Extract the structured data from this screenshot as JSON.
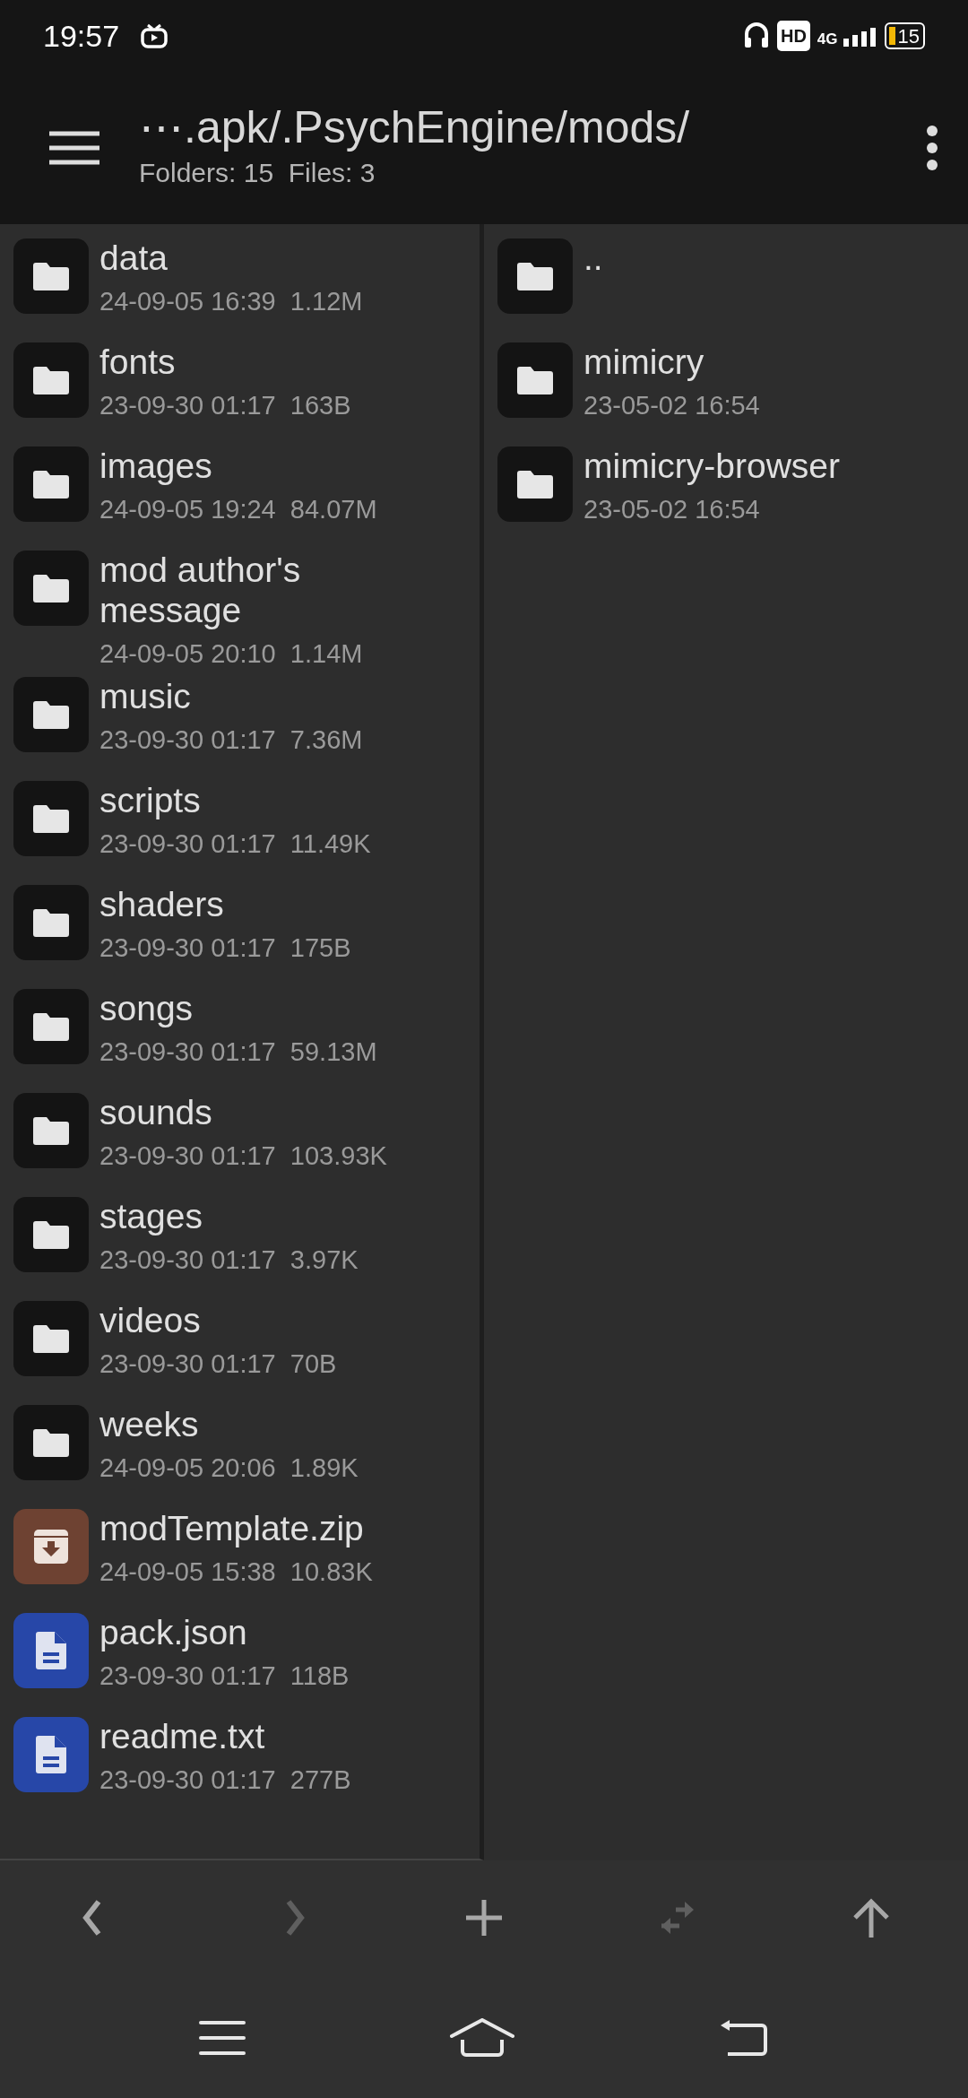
{
  "status_bar": {
    "time": "19:57",
    "hd": "HD",
    "network": "4G",
    "battery": "15"
  },
  "header": {
    "path": "⋯.apk/.PsychEngine/mods/",
    "summary": "Folders: 15  Files: 3"
  },
  "left_pane": {
    "items": [
      {
        "kind": "folder",
        "name": "data",
        "meta": "24-09-05 16:39  1.12M"
      },
      {
        "kind": "folder",
        "name": "fonts",
        "meta": "23-09-30 01:17  163B"
      },
      {
        "kind": "folder",
        "name": "images",
        "meta": "24-09-05 19:24  84.07M"
      },
      {
        "kind": "folder",
        "name": "mod author's message",
        "meta": "24-09-05 20:10  1.14M"
      },
      {
        "kind": "folder",
        "name": "music",
        "meta": "23-09-30 01:17  7.36M"
      },
      {
        "kind": "folder",
        "name": "scripts",
        "meta": "23-09-30 01:17  11.49K"
      },
      {
        "kind": "folder",
        "name": "shaders",
        "meta": "23-09-30 01:17  175B"
      },
      {
        "kind": "folder",
        "name": "songs",
        "meta": "23-09-30 01:17  59.13M"
      },
      {
        "kind": "folder",
        "name": "sounds",
        "meta": "23-09-30 01:17  103.93K"
      },
      {
        "kind": "folder",
        "name": "stages",
        "meta": "23-09-30 01:17  3.97K"
      },
      {
        "kind": "folder",
        "name": "videos",
        "meta": "23-09-30 01:17  70B"
      },
      {
        "kind": "folder",
        "name": "weeks",
        "meta": "24-09-05 20:06  1.89K"
      },
      {
        "kind": "archive",
        "name": "modTemplate.zip",
        "meta": "24-09-05 15:38  10.83K"
      },
      {
        "kind": "document",
        "name": "pack.json",
        "meta": "23-09-30 01:17  118B"
      },
      {
        "kind": "document",
        "name": "readme.txt",
        "meta": "23-09-30 01:17  277B"
      }
    ]
  },
  "right_pane": {
    "items": [
      {
        "kind": "folder",
        "name": ".."
      },
      {
        "kind": "folder",
        "name": "mimicry",
        "meta": "23-05-02 16:54"
      },
      {
        "kind": "folder",
        "name": "mimicry-browser",
        "meta": "23-05-02 16:54"
      }
    ]
  },
  "toolbar": [
    {
      "kind": "back",
      "disabled": false
    },
    {
      "kind": "forward",
      "disabled": true
    },
    {
      "kind": "add",
      "disabled": false
    },
    {
      "kind": "swap",
      "disabled": true
    },
    {
      "kind": "up",
      "disabled": false
    }
  ]
}
